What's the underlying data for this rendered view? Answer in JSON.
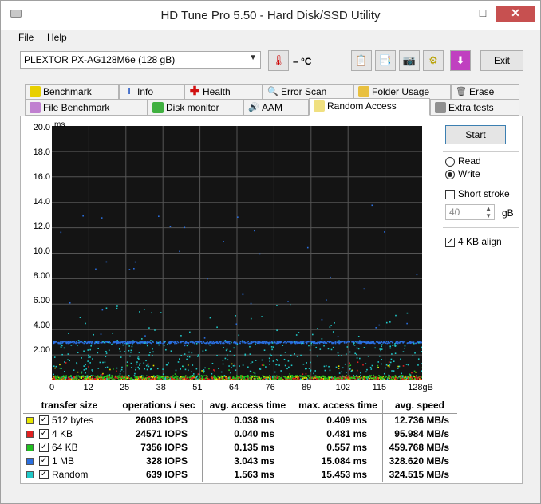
{
  "window": {
    "title": "HD Tune Pro 5.50 - Hard Disk/SSD Utility",
    "min": "–",
    "max": "□",
    "close": "✕"
  },
  "menu": [
    "File",
    "Help"
  ],
  "toolbar": {
    "drive": "PLEXTOR PX-AG128M6e (128 gB)",
    "temp": "– °C",
    "exit": "Exit"
  },
  "tabs_top": [
    "Benchmark",
    "Info",
    "Health",
    "Error Scan",
    "Folder Usage",
    "Erase"
  ],
  "tabs_bottom": [
    "File Benchmark",
    "Disk monitor",
    "AAM",
    "Random Access",
    "Extra tests"
  ],
  "chart": {
    "y_unit": "ms",
    "y_ticks": [
      "20.0",
      "18.0",
      "16.0",
      "14.0",
      "12.0",
      "10.0",
      "8.00",
      "6.00",
      "4.00",
      "2.00"
    ],
    "x_ticks": [
      "0",
      "12",
      "25",
      "38",
      "51",
      "64",
      "76",
      "89",
      "102",
      "115",
      "128gB"
    ]
  },
  "chart_data": {
    "type": "scatter",
    "ylim": [
      0,
      20
    ],
    "xlim": [
      0,
      128
    ],
    "series": [
      {
        "name": "512 bytes",
        "color": "#e6e600",
        "typical_y": 0.04
      },
      {
        "name": "4 KB",
        "color": "#e02020",
        "typical_y": 0.04
      },
      {
        "name": "64 KB",
        "color": "#20c020",
        "typical_y": 0.14
      },
      {
        "name": "1 MB",
        "color": "#2a6fe0",
        "typical_y": 3.04
      },
      {
        "name": "Random",
        "color": "#20c8c8",
        "typical_y": 1.56
      }
    ]
  },
  "side": {
    "start": "Start",
    "read": "Read",
    "write": "Write",
    "short_stroke": "Short stroke",
    "stroke_value": "40",
    "unit": "gB",
    "align": "4 KB align"
  },
  "table": {
    "headers": [
      "transfer size",
      "operations / sec",
      "avg. access time",
      "max. access time",
      "avg. speed"
    ],
    "rows": [
      {
        "color": "#e6e600",
        "label": "512 bytes",
        "ops": "26083 IOPS",
        "avg": "0.038 ms",
        "max": "0.409 ms",
        "speed": "12.736 MB/s"
      },
      {
        "color": "#e02020",
        "label": "4 KB",
        "ops": "24571 IOPS",
        "avg": "0.040 ms",
        "max": "0.481 ms",
        "speed": "95.984 MB/s"
      },
      {
        "color": "#20c020",
        "label": "64 KB",
        "ops": "7356 IOPS",
        "avg": "0.135 ms",
        "max": "0.557 ms",
        "speed": "459.768 MB/s"
      },
      {
        "color": "#2a6fe0",
        "label": "1 MB",
        "ops": "328 IOPS",
        "avg": "3.043 ms",
        "max": "15.084 ms",
        "speed": "328.620 MB/s"
      },
      {
        "color": "#20c8c8",
        "label": "Random",
        "ops": "639 IOPS",
        "avg": "1.563 ms",
        "max": "15.453 ms",
        "speed": "324.515 MB/s"
      }
    ]
  }
}
